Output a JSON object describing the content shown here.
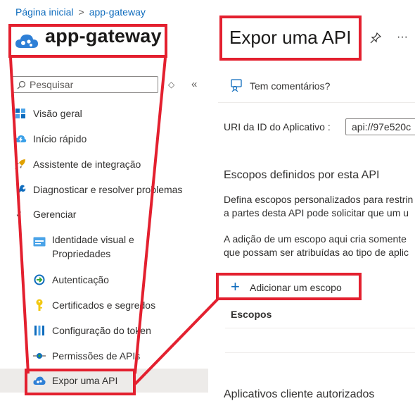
{
  "breadcrumb": {
    "home": "Página inicial",
    "current": "app-gateway"
  },
  "app": {
    "name": "app-gateway"
  },
  "page": {
    "title": "Expor uma API",
    "pin_icon": "pin-icon",
    "more_icon": "ellipsis-icon"
  },
  "search": {
    "placeholder": "Pesquisar"
  },
  "nav": {
    "overview": "Visão geral",
    "quickstart": "Início rápido",
    "integration": "Assistente de integração",
    "diagnose": "Diagnosticar e resolver problemas",
    "manage": "Gerenciar",
    "branding": "Identidade visual e Propriedades",
    "branding_line1": "Identidade visual e",
    "branding_line2": "Propriedades",
    "authentication": "Autenticação",
    "certificates": "Certificados e segredos",
    "token": "Configuração do token",
    "permissions": "Permissões de APIs",
    "expose": "Expor uma API"
  },
  "toolbar": {
    "feedback": "Tem comentários?"
  },
  "uri": {
    "label": "URI da ID do Aplicativo :",
    "value": "api://97e520c"
  },
  "scopes": {
    "title": "Escopos definidos por esta API",
    "desc1_line1": "Defina escopos personalizados para restrin",
    "desc1_line2": "a partes desta API pode solicitar que um u",
    "desc2_line1": "A adição de um escopo aqui cria somente",
    "desc2_line2": "que possam ser atribuídas ao tipo de aplic",
    "add_button": "Adicionar um escopo",
    "column_header": "Escopos"
  },
  "authorized_clients": {
    "title": "Aplicativos cliente autorizados"
  },
  "colors": {
    "accent": "#0f6cbd",
    "highlight": "#e3202f",
    "active_bg": "#edebe9"
  }
}
